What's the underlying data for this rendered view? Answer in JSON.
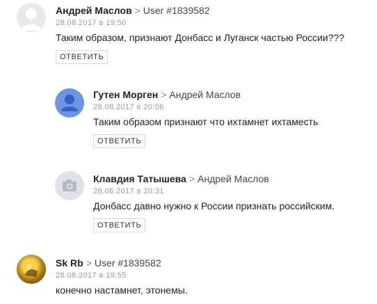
{
  "reply_label": "ОТВЕТИТЬ",
  "comments": [
    {
      "author": "Андрей Маслов",
      "reply_to": "User #1839582",
      "date": "28.08.2017 в 19:50",
      "text": "Таким образом, признают Донбасс и Луганск частью России???",
      "avatar": "user-placeholder-gray"
    },
    {
      "author": "Гутен Морген",
      "reply_to": "Андрей Маслов",
      "date": "28.08.2017 в 20:06",
      "text": "Таким образом признают что ихтамнет ихтаместь",
      "avatar": "user-placeholder-blue"
    },
    {
      "author": "Клавдия Татышева",
      "reply_to": "Андрей Маслов",
      "date": "28.08.2017 в 20:31",
      "text": "Донбасс давно нужно к России признать российским.",
      "avatar": "camera-placeholder"
    },
    {
      "author": "Sk Rb",
      "reply_to": "User #1839582",
      "date": "28.08.2017 в 19:55",
      "text": "конечно настамнет, этонемы.",
      "avatar": "photo"
    }
  ],
  "colors": {
    "author": "#222222",
    "meta": "#9a9a9a",
    "avatar_blue": "#6e95e4"
  }
}
